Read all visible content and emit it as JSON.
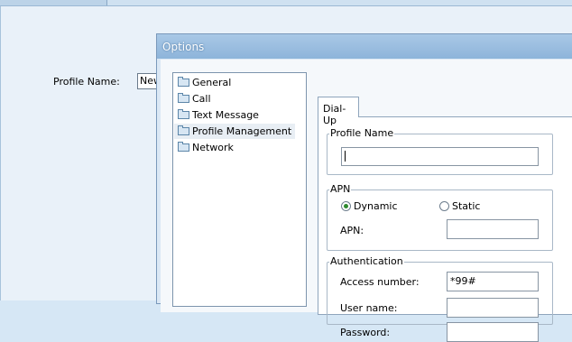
{
  "background_form": {
    "profile_name_label": "Profile Name:",
    "profile_name_value": "New"
  },
  "dialog": {
    "title": "Options",
    "tree_items": [
      "General",
      "Call",
      "Text Message",
      "Profile Management",
      "Network"
    ],
    "selected_tree_item": "Profile Management",
    "tab_label": "Dial-Up",
    "profile_name_group": {
      "legend": "Profile Name",
      "value": ""
    },
    "apn_group": {
      "legend": "APN",
      "dynamic_label": "Dynamic",
      "static_label": "Static",
      "selected": "Dynamic",
      "apn_label": "APN:",
      "apn_value": ""
    },
    "authentication_group": {
      "legend": "Authentication",
      "access_number_label": "Access number:",
      "access_number_value": "*99#",
      "user_name_label": "User name:",
      "user_name_value": "",
      "password_label": "Password:",
      "password_value": ""
    }
  }
}
